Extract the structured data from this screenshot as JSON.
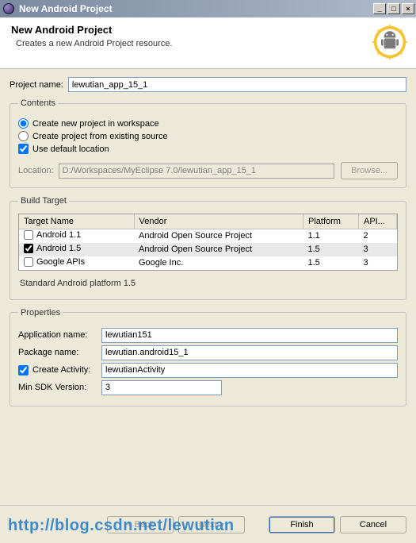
{
  "window": {
    "title": "New Android Project"
  },
  "header": {
    "title": "New Android Project",
    "subtitle": "Creates a new Android Project resource."
  },
  "project": {
    "name_label": "Project name:",
    "name_value": "lewutian_app_15_1"
  },
  "contents": {
    "legend": "Contents",
    "create_new_label": "Create new project in workspace",
    "create_existing_label": "Create project from existing source",
    "use_default_label": "Use default location",
    "location_label": "Location:",
    "location_value": "D:/Workspaces/MyEclipse 7.0/lewutian_app_15_1",
    "browse_label": "Browse..."
  },
  "build": {
    "legend": "Build Target",
    "columns": {
      "target": "Target Name",
      "vendor": "Vendor",
      "platform": "Platform",
      "api": "API..."
    },
    "rows": [
      {
        "name": "Android 1.1",
        "vendor": "Android Open Source Project",
        "platform": "1.1",
        "api": "2",
        "checked": false
      },
      {
        "name": "Android 1.5",
        "vendor": "Android Open Source Project",
        "platform": "1.5",
        "api": "3",
        "checked": true
      },
      {
        "name": "Google APIs",
        "vendor": "Google Inc.",
        "platform": "1.5",
        "api": "3",
        "checked": false
      }
    ],
    "note": "Standard Android platform 1.5"
  },
  "props": {
    "legend": "Properties",
    "app_label": "Application name:",
    "app_value": "lewutian151",
    "pkg_label": "Package name:",
    "pkg_value": "lewutian.android15_1",
    "activity_label": "Create Activity:",
    "activity_value": "lewutianActivity",
    "minsdk_label": "Min SDK Version:",
    "minsdk_value": "3"
  },
  "footer": {
    "back": "< Back",
    "next": "Next >",
    "finish": "Finish",
    "cancel": "Cancel"
  },
  "watermark": "http://blog.csdn.net/lewutian"
}
